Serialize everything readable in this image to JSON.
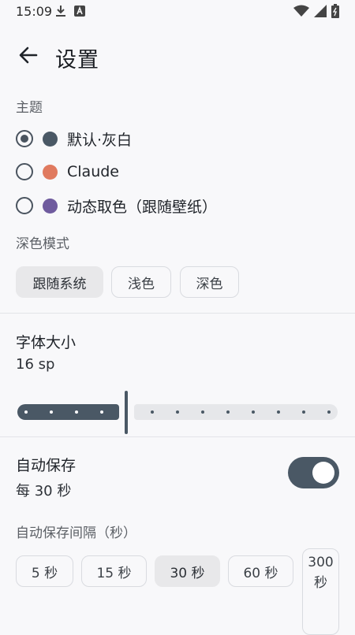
{
  "status_bar": {
    "time": "15:09"
  },
  "header": {
    "title": "设置"
  },
  "theme": {
    "label": "主题",
    "options": [
      {
        "label": "默认·灰白",
        "color": "#4a5865",
        "selected": true
      },
      {
        "label": "Claude",
        "color": "#e07a5f",
        "selected": false
      },
      {
        "label": "动态取色（跟随壁纸）",
        "color": "#6f5b9e",
        "selected": false
      }
    ]
  },
  "dark_mode": {
    "label": "深色模式",
    "options": [
      "跟随系统",
      "浅色",
      "深色"
    ],
    "selected": "跟随系统"
  },
  "font_size": {
    "label": "字体大小",
    "value": "16 sp"
  },
  "autosave": {
    "label": "自动保存",
    "value": "每 30 秒",
    "enabled": true,
    "interval_label": "自动保存间隔（秒）",
    "interval_options": [
      "5 秒",
      "15 秒",
      "30 秒",
      "60 秒"
    ],
    "interval_partial": "300 秒",
    "selected": "30 秒"
  },
  "colors": {
    "accent": "#4a5865"
  }
}
